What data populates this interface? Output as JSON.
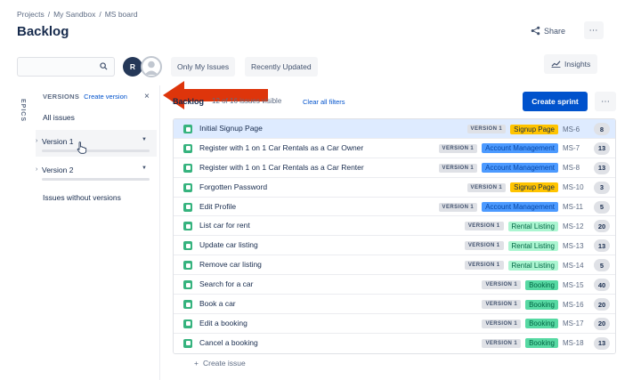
{
  "breadcrumb": [
    "Projects",
    "My Sandbox",
    "MS board"
  ],
  "page_title": "Backlog",
  "header": {
    "share_label": "Share",
    "more_label": "⋯"
  },
  "toolbar": {
    "search_placeholder": "",
    "avatar_initial": "R",
    "only_my_issues": "Only My Issues",
    "recently_updated": "Recently Updated",
    "insights": "Insights"
  },
  "epics_tab_label": "EPICS",
  "versions_panel": {
    "title": "VERSIONS",
    "create_link": "Create version",
    "close": "×",
    "all_issues": "All issues",
    "versions": [
      {
        "name": "Version 1"
      },
      {
        "name": "Version 2"
      }
    ],
    "no_versions": "Issues without versions"
  },
  "backlog": {
    "title": "Backlog",
    "count_text": "12 of 16 issues visible",
    "clear_filters": "Clear all filters",
    "create_sprint": "Create sprint",
    "more": "⋯",
    "create_issue": "Create issue"
  },
  "colors": {
    "accent": "#0052cc",
    "story": "#36b37e",
    "annotation_arrow": "#de350b"
  },
  "issues": [
    {
      "summary": "Initial Signup Page",
      "version": "VERSION 1",
      "epic": "Signup Page",
      "epic_style": "signup",
      "key": "MS-6",
      "points": "8",
      "selected": true
    },
    {
      "summary": "Register with 1 on 1 Car Rentals as a Car Owner",
      "version": "VERSION 1",
      "epic": "Account Management",
      "epic_style": "account",
      "key": "MS-7",
      "points": "13",
      "selected": false
    },
    {
      "summary": "Register with 1 on 1 Car Rentals as a Car Renter",
      "version": "VERSION 1",
      "epic": "Account Management",
      "epic_style": "account",
      "key": "MS-8",
      "points": "13",
      "selected": false
    },
    {
      "summary": "Forgotten Password",
      "version": "VERSION 1",
      "epic": "Signup Page",
      "epic_style": "signup",
      "key": "MS-10",
      "points": "3",
      "selected": false
    },
    {
      "summary": "Edit Profile",
      "version": "VERSION 1",
      "epic": "Account Management",
      "epic_style": "account",
      "key": "MS-11",
      "points": "5",
      "selected": false
    },
    {
      "summary": "List car for rent",
      "version": "VERSION 1",
      "epic": "Rental Listing",
      "epic_style": "rental",
      "key": "MS-12",
      "points": "20",
      "selected": false
    },
    {
      "summary": "Update car listing",
      "version": "VERSION 1",
      "epic": "Rental Listing",
      "epic_style": "rental",
      "key": "MS-13",
      "points": "13",
      "selected": false
    },
    {
      "summary": "Remove car listing",
      "version": "VERSION 1",
      "epic": "Rental Listing",
      "epic_style": "rental",
      "key": "MS-14",
      "points": "5",
      "selected": false
    },
    {
      "summary": "Search for a car",
      "version": "VERSION 1",
      "epic": "Booking",
      "epic_style": "booking",
      "key": "MS-15",
      "points": "40",
      "selected": false
    },
    {
      "summary": "Book a car",
      "version": "VERSION 1",
      "epic": "Booking",
      "epic_style": "booking",
      "key": "MS-16",
      "points": "20",
      "selected": false
    },
    {
      "summary": "Edit a booking",
      "version": "VERSION 1",
      "epic": "Booking",
      "epic_style": "booking",
      "key": "MS-17",
      "points": "20",
      "selected": false
    },
    {
      "summary": "Cancel a booking",
      "version": "VERSION 1",
      "epic": "Booking",
      "epic_style": "booking",
      "key": "MS-18",
      "points": "13",
      "selected": false
    }
  ]
}
